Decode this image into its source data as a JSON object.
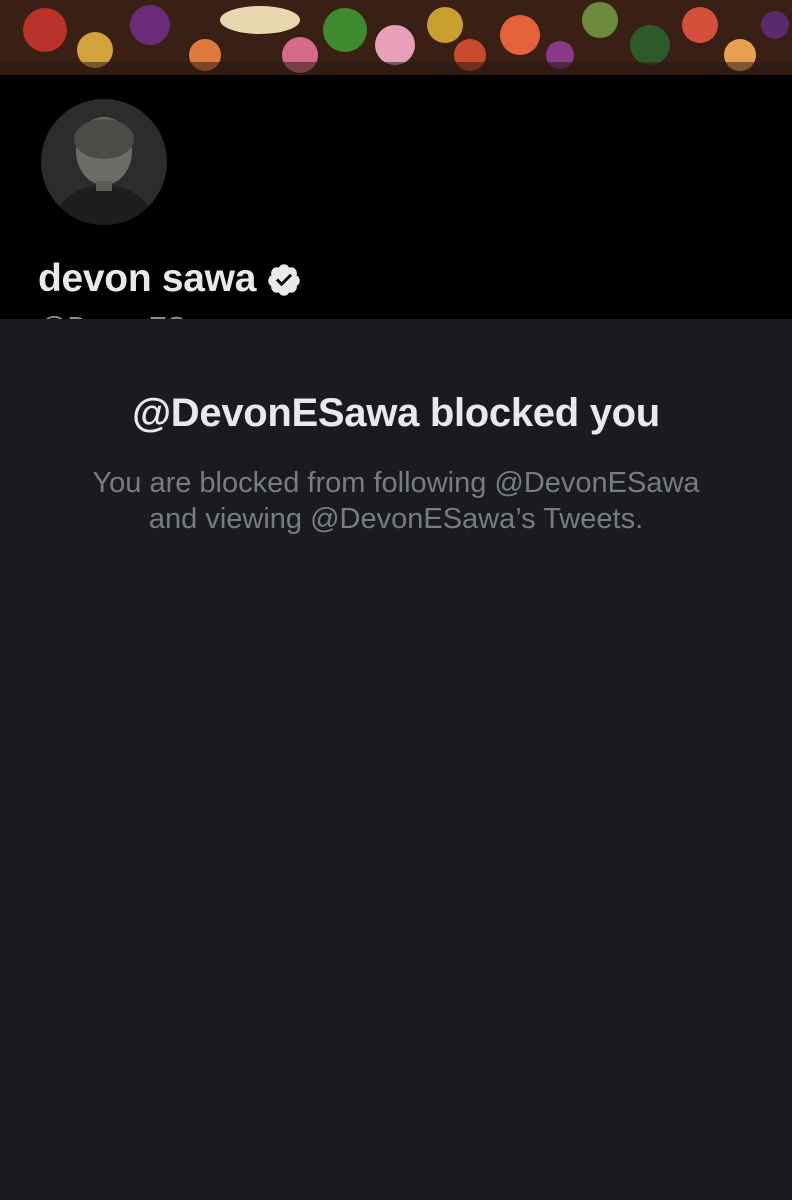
{
  "profile": {
    "display_name": "devon sawa",
    "handle": "@DevonESawa",
    "verified_icon": "verified-badge-icon",
    "banner_image": "muppets-collage-banner",
    "avatar_image": "profile-photo"
  },
  "blocked": {
    "title": "@DevonESawa blocked you",
    "message_line1": "You are blocked from following @DevonESawa",
    "message_line2": "and viewing @DevonESawa’s Tweets."
  },
  "colors": {
    "header_bg": "#000000",
    "content_bg": "#1a1b1f",
    "primary_text": "#e7e9ea",
    "secondary_text": "#8b8f94"
  }
}
